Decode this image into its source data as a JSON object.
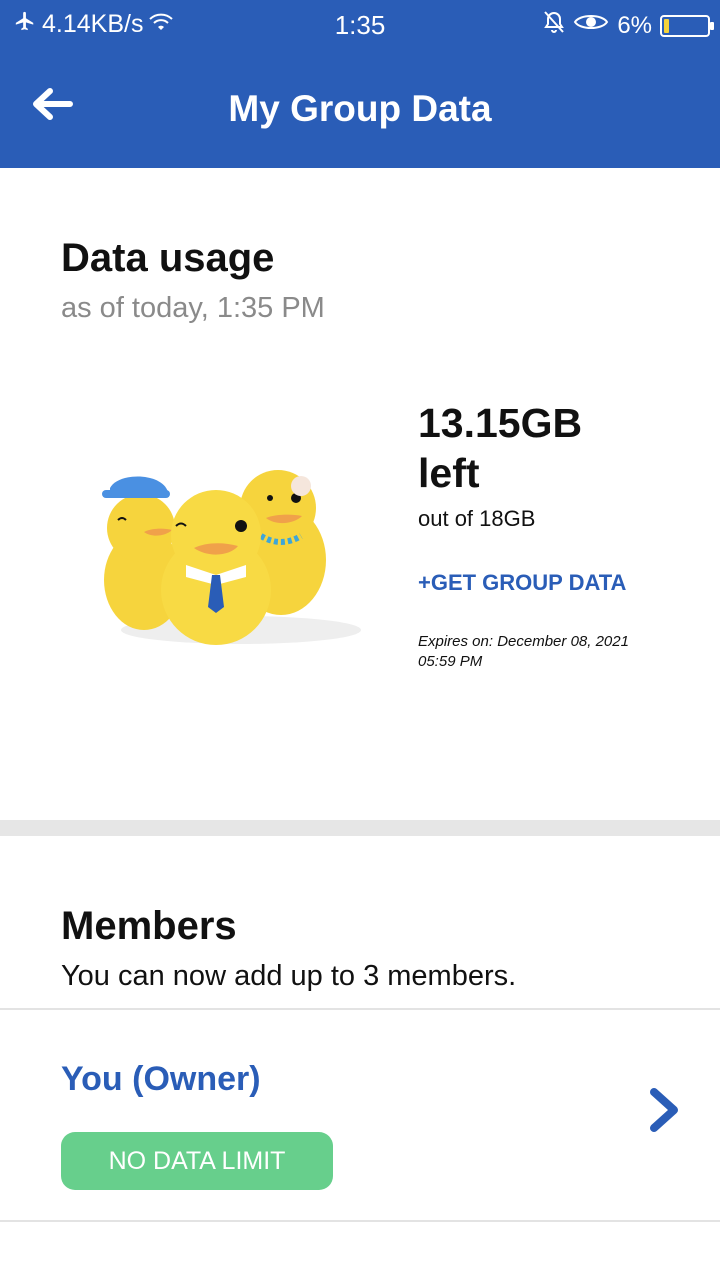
{
  "status_bar": {
    "net_speed": "4.14KB/s",
    "time": "1:35",
    "battery": "6%",
    "battery_level": 0.06,
    "icons": [
      "airplane-icon",
      "wifi-icon",
      "mute-bell-icon",
      "eye-icon",
      "battery-icon"
    ]
  },
  "app_bar": {
    "title": "My Group Data",
    "back_icon": "arrow-left-icon"
  },
  "usage": {
    "title": "Data usage",
    "subtitle": "as of today, 1:35 PM",
    "amount_left": "13.15GB",
    "left_word": "left",
    "out_of": "out of 18GB",
    "get_group_data": "+GET GROUP DATA",
    "expires": "Expires on: December 08, 2021 05:59 PM",
    "illustration": "ducks-illustration"
  },
  "members": {
    "title": "Members",
    "subtitle": "You can now add up to 3 members.",
    "list": [
      {
        "name": "You (Owner)",
        "badge": "NO DATA LIMIT",
        "icon": "chevron-right-icon"
      }
    ]
  },
  "colors": {
    "brand_blue": "#2a5db7",
    "badge_green": "#67cf8c"
  }
}
